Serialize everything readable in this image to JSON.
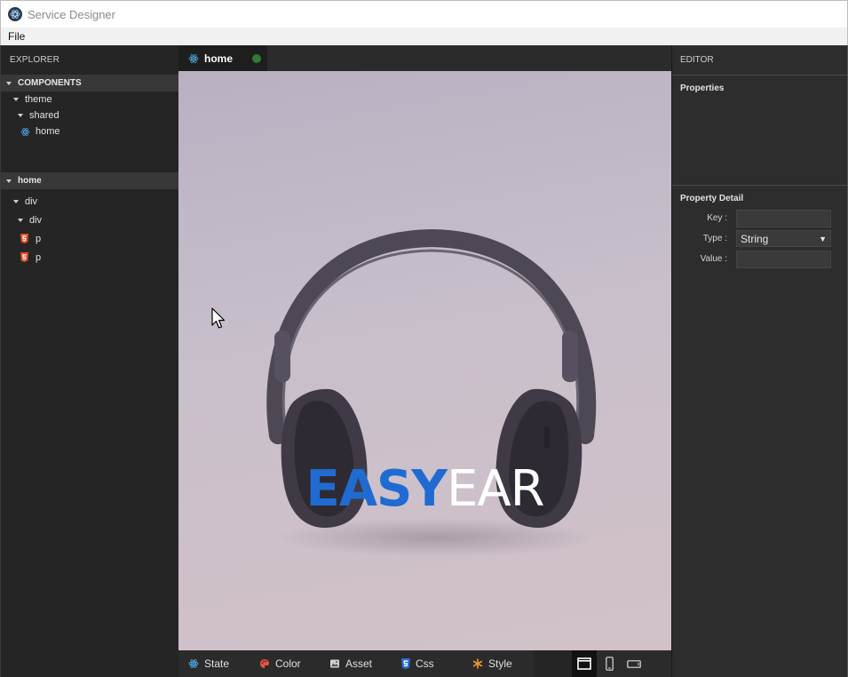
{
  "window": {
    "title": "Service Designer"
  },
  "menu": {
    "file": "File"
  },
  "explorer": {
    "header": "EXPLORER",
    "components_section": "COMPONENTS",
    "components_tree": [
      {
        "label": "theme",
        "depth": 1,
        "icon": "caret"
      },
      {
        "label": "shared",
        "depth": 2,
        "icon": "caret"
      },
      {
        "label": "home",
        "depth": 2,
        "icon": "react-icon"
      }
    ],
    "home_section": "home",
    "home_tree": [
      {
        "label": "div",
        "depth": 1,
        "icon": "caret"
      },
      {
        "label": "div",
        "depth": 2,
        "icon": "caret"
      },
      {
        "label": "p",
        "depth": 2,
        "icon": "html5-icon"
      },
      {
        "label": "p",
        "depth": 2,
        "icon": "html5-icon"
      }
    ]
  },
  "tabs": [
    {
      "label": "home",
      "status_color": "#2f7d32"
    }
  ],
  "preview": {
    "brand_part1": "EASY",
    "brand_part2": "EAR",
    "brand_part1_color": "#1f6bd1",
    "brand_part2_color": "#ffffff",
    "image_subject": "headphones"
  },
  "bottom_toolbar": {
    "items": [
      "State",
      "Color",
      "Asset",
      "Css",
      "Style"
    ],
    "view_modes": [
      "desktop-icon",
      "mobile-icon",
      "tablet-landscape-icon"
    ],
    "active_view": "desktop-icon"
  },
  "editor": {
    "header": "EDITOR",
    "properties_title": "Properties",
    "property_detail_title": "Property Detail",
    "key_label": "Key :",
    "key_value": "",
    "type_label": "Type :",
    "type_value": "String",
    "value_label": "Value :",
    "value_value": ""
  }
}
